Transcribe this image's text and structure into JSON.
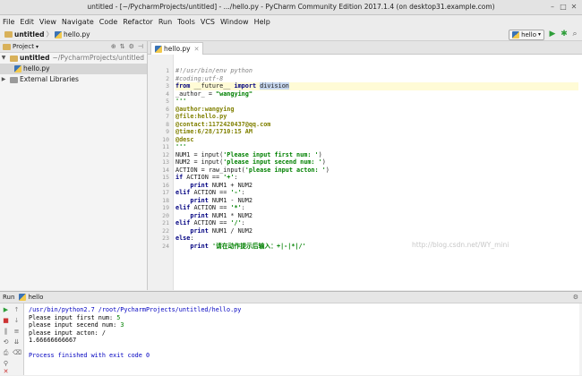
{
  "window": {
    "title": "untitled - [~/PycharmProjects/untitled] - .../hello.py - PyCharm Community Edition 2017.1.4 (on desktop31.example.com)"
  },
  "menu": [
    "File",
    "Edit",
    "View",
    "Navigate",
    "Code",
    "Refactor",
    "Run",
    "Tools",
    "VCS",
    "Window",
    "Help"
  ],
  "breadcrumb": {
    "project": "untitled",
    "file": "hello.py"
  },
  "toolbar": {
    "run_config": "hello"
  },
  "project_panel": {
    "title": "Project",
    "root": "untitled",
    "root_path": "~/PycharmProjects/untitled",
    "file": "hello.py",
    "external": "External Libraries"
  },
  "editor": {
    "tab_label": "hello.py",
    "line_numbers": [
      "1",
      "2",
      "3",
      "4",
      "5",
      "6",
      "7",
      "8",
      "9",
      "10",
      "11",
      "12",
      "13",
      "14",
      "15",
      "16",
      "17",
      "18",
      "19",
      "20",
      "21",
      "22",
      "23",
      "24"
    ],
    "watermark": "http://blog.csdn.net/WY_mini"
  },
  "run": {
    "label": "Run",
    "config": "hello",
    "console": {
      "command": "/usr/bin/python2.7 /root/PycharmProjects/untitled/hello.py",
      "l1_prompt": "Please input first num: ",
      "l1_input": "5",
      "l2_prompt": "please input secend num: ",
      "l2_input": "3",
      "l3": "please input acton: /",
      "l4": "1.66666666667",
      "exit": "Process finished with exit code 0"
    }
  }
}
